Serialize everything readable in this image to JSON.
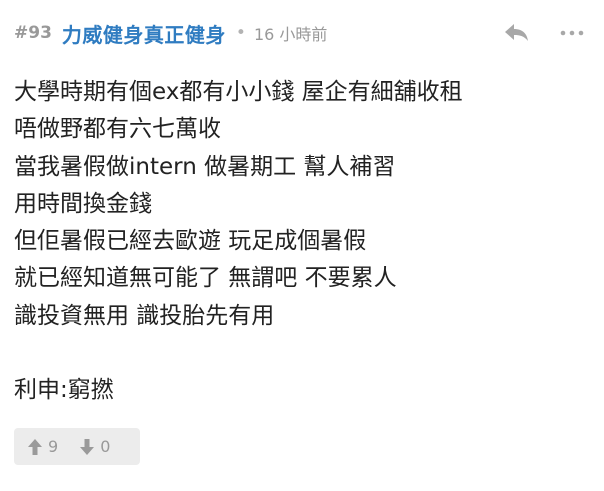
{
  "post": {
    "number": "#93",
    "username": "力威健身真正健身",
    "separator": "•",
    "timestamp": "16 小時前",
    "content_lines": [
      "大學時期有個ex都有小小錢 屋企有細舖收租",
      "唔做野都有六七萬收",
      "當我暑假做intern 做暑期工 幫人補習",
      "用時間換金錢",
      "但佢暑假已經去歐遊 玩足成個暑假",
      "就已經知道無可能了 無謂吧 不要累人",
      "識投資無用 識投胎先有用",
      "",
      "利申:窮撚"
    ],
    "upvotes": "9",
    "downvotes": "0"
  },
  "icons": {
    "reply": "reply-icon",
    "more": "more-options-icon",
    "upvote": "arrow-up-icon",
    "downvote": "arrow-down-icon"
  },
  "colors": {
    "username": "#2f7cc1",
    "meta": "#999999",
    "text": "#222222",
    "vote_bg": "#ececec"
  }
}
